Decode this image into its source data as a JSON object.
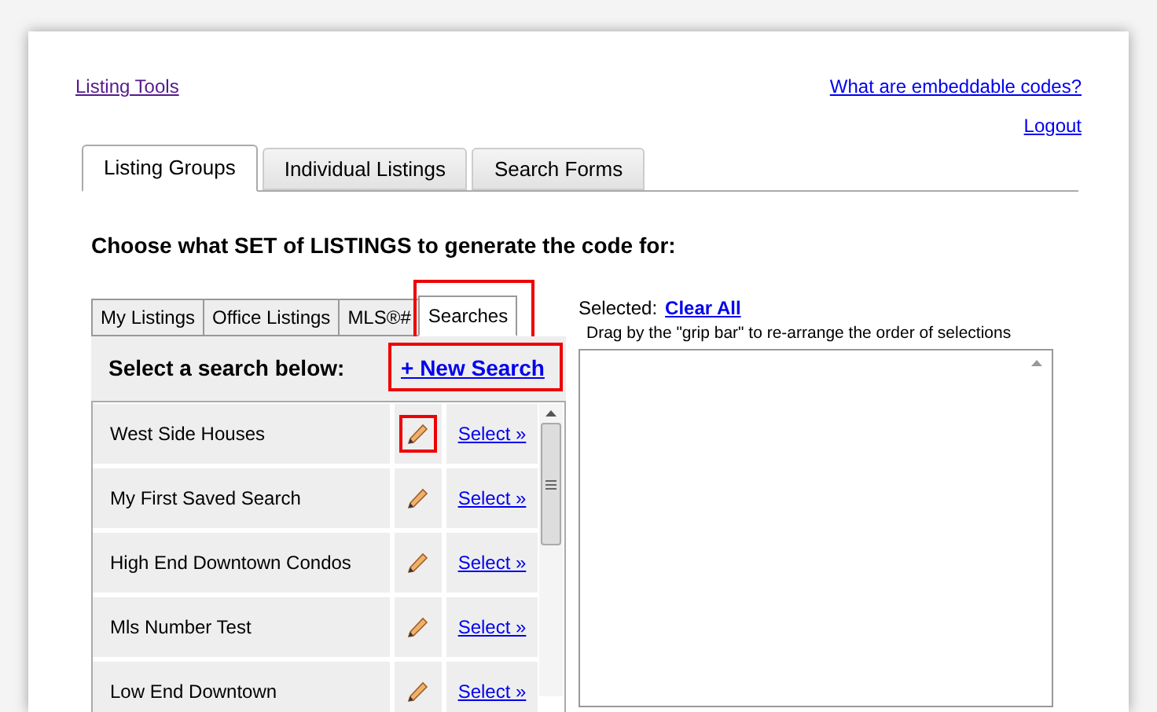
{
  "links": {
    "listing_tools": "Listing Tools",
    "help": "What are embeddable codes?",
    "logout": "Logout"
  },
  "tabs": [
    {
      "label": "Listing Groups",
      "selected": true
    },
    {
      "label": "Individual Listings",
      "selected": false
    },
    {
      "label": "Search Forms",
      "selected": false
    }
  ],
  "heading": "Choose what SET of LISTINGS to generate the code for:",
  "subtabs": [
    {
      "label": "My Listings",
      "selected": false,
      "highlighted": false
    },
    {
      "label": "Office Listings",
      "selected": false,
      "highlighted": false
    },
    {
      "label": "MLS®#",
      "selected": false,
      "highlighted": false
    },
    {
      "label": "Searches",
      "selected": true,
      "highlighted": true
    }
  ],
  "search_panel": {
    "title": "Select a search below:",
    "new_search": {
      "label": "+ New Search",
      "highlighted": true
    }
  },
  "searches": [
    {
      "name": "West Side Houses",
      "action": "Select »",
      "edit_highlighted": true
    },
    {
      "name": "My First Saved Search",
      "action": "Select »",
      "edit_highlighted": false
    },
    {
      "name": "High End Downtown Condos",
      "action": "Select »",
      "edit_highlighted": false
    },
    {
      "name": "Mls Number Test",
      "action": "Select »",
      "edit_highlighted": false
    },
    {
      "name": "Low End Downtown",
      "action": "Select »",
      "edit_highlighted": false
    }
  ],
  "selected_panel": {
    "label": "Selected:",
    "clear_all": "Clear All",
    "hint": "Drag by the \"grip bar\" to re-arrange the order of selections"
  }
}
